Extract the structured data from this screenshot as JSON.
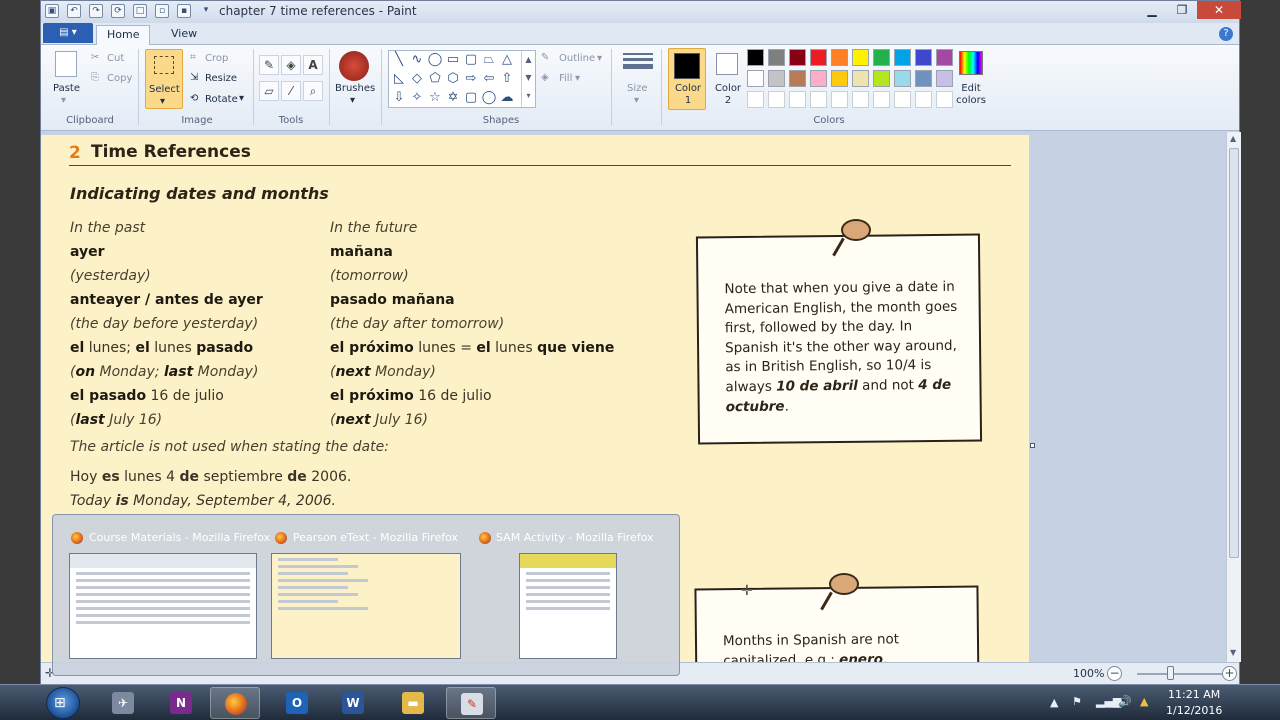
{
  "window": {
    "title": "chapter 7 time references - Paint"
  },
  "tabs": {
    "file": "▤ ▾",
    "home": "Home",
    "view": "View"
  },
  "clipboard": {
    "paste": "Paste",
    "cut": "Cut",
    "copy": "Copy",
    "group": "Clipboard"
  },
  "image": {
    "select": "Select",
    "crop": "Crop",
    "resize": "Resize",
    "rotate": "Rotate",
    "group": "Image"
  },
  "tools": {
    "group": "Tools"
  },
  "brushes": {
    "label": "Brushes"
  },
  "shapes": {
    "outline": "Outline",
    "fill": "Fill",
    "group": "Shapes"
  },
  "size": {
    "label": "Size"
  },
  "colors": {
    "color1": "Color 1",
    "color2": "Color 2",
    "edit": "Edit colors",
    "group": "Colors",
    "row1": [
      "#000000",
      "#7f7f7f",
      "#880015",
      "#ed1c24",
      "#ff7f27",
      "#fff200",
      "#22b14c",
      "#00a2e8",
      "#3f48cc",
      "#a349a4"
    ],
    "row2": [
      "#ffffff",
      "#c3c3c3",
      "#b97a57",
      "#ffaec9",
      "#ffc90e",
      "#efe4b0",
      "#b5e61d",
      "#99d9ea",
      "#7092be",
      "#c8bfe7"
    ]
  },
  "document": {
    "section_number": "2",
    "section_title": "Time References",
    "subhead": "Indicating dates and months",
    "left": [
      "In the past",
      "ayer",
      "(yesterday)",
      "anteayer / antes de ayer",
      "(the day before yesterday)",
      "el lunes; el lunes pasado",
      "(on Monday; last Monday)",
      "el pasado 16 de julio",
      "(last July 16)"
    ],
    "right": [
      "In the future",
      "mañana",
      "(tomorrow)",
      "pasado mañana",
      "(the day after tomorrow)",
      "el próximo lunes = el lunes que viene",
      "(next Monday)",
      "el próximo 16 de julio",
      "(next July 16)"
    ],
    "article_note": "The article is not used when stating the date:",
    "example_es": "Hoy es lunes 4 de septiembre de 2006.",
    "example_en": "Today is Monday, September 4, 2006.",
    "note1": "Note that when you give a date in American English, the month goes first, followed by the day. In Spanish it's the other way around, as in British English, so 10/4 is always 10 de abril and not 4 de octubre.",
    "note2": "Months in Spanish are not capitalized, e.g.: enero."
  },
  "status": {
    "zoom": "100%"
  },
  "thumbnails": [
    {
      "title": "Course Materials - Mozilla Firefox"
    },
    {
      "title": "Pearson eText - Mozilla Firefox"
    },
    {
      "title": "SAM Activity - Mozilla Firefox"
    }
  ],
  "clock": {
    "time": "11:21 AM",
    "date": "1/12/2016"
  }
}
